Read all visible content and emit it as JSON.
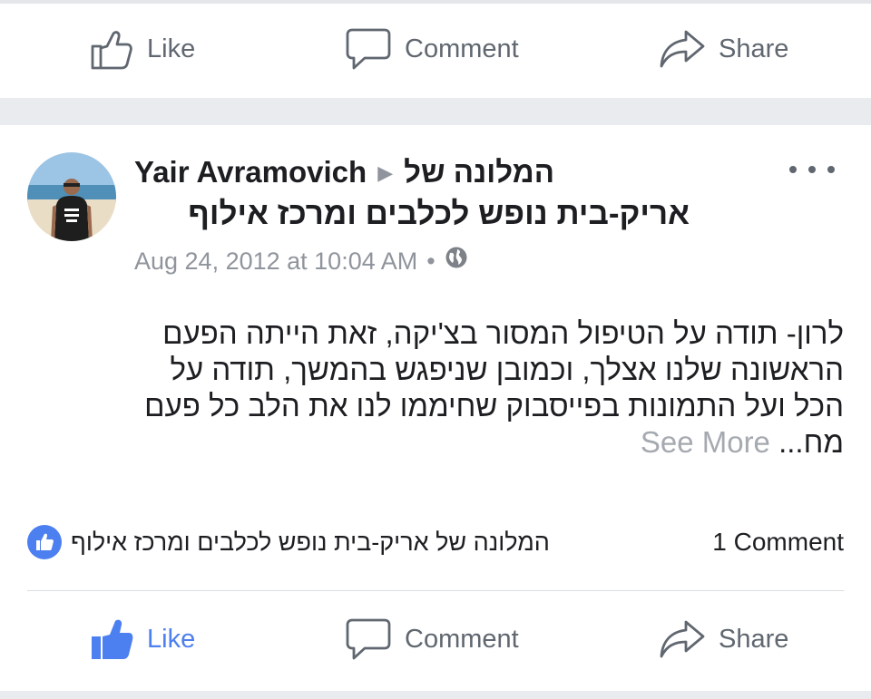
{
  "top_actions": {
    "like": "Like",
    "comment": "Comment",
    "share": "Share"
  },
  "post": {
    "author": "Yair Avramovich",
    "page_prefix": "המלונה של",
    "page_name": "אריק-בית נופש לכלבים ומרכז אילוף",
    "timestamp": "Aug 24, 2012 at 10:04 AM",
    "text_lines": [
      "לרון- תודה על הטיפול המסור בצ'יקה, זאת הייתה הפעם",
      "הראשונה שלנו אצלך, וכמובן שניפגש בהמשך, תודה על",
      "הכל ועל התמונות בפייסבוק שחיממו לנו את הלב כל פעם",
      "מח..."
    ],
    "see_more": "See More"
  },
  "reactions": {
    "reactor": "המלונה של אריק-בית נופש לכלבים ומרכז אילוף",
    "comment_count": "1 Comment"
  },
  "bottom_actions": {
    "like": "Like",
    "comment": "Comment",
    "share": "Share"
  },
  "colors": {
    "accent": "#4c7ff0",
    "muted": "#606770",
    "separator": "#e9ebee"
  }
}
